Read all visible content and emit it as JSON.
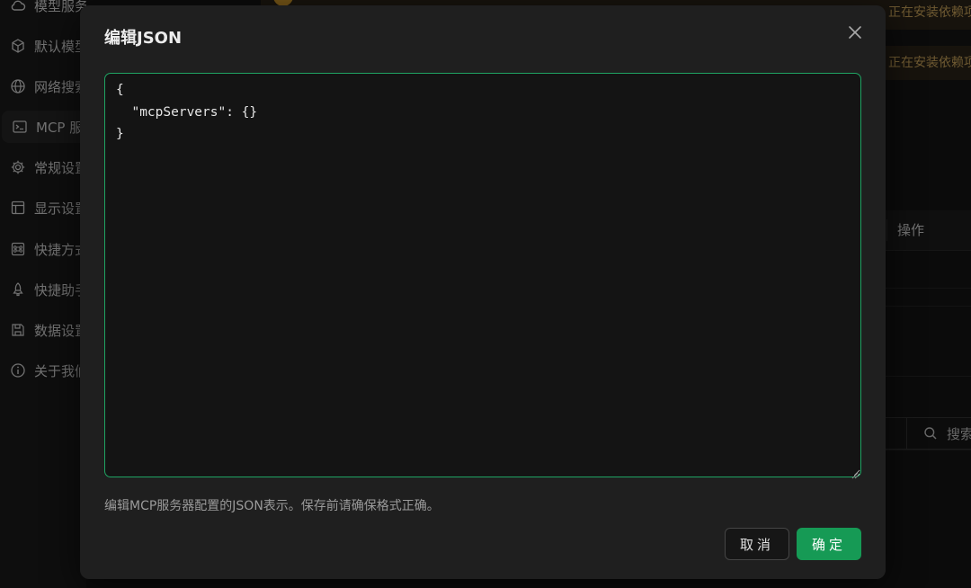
{
  "sidebar": {
    "items": [
      {
        "label": "模型服务",
        "icon": "cloud-icon"
      },
      {
        "label": "默认模型",
        "icon": "cube-icon"
      },
      {
        "label": "网络搜索",
        "icon": "globe-icon"
      },
      {
        "label": "MCP 服务器",
        "icon": "terminal-icon",
        "active": true
      },
      {
        "label": "常规设置",
        "icon": "gear-icon"
      },
      {
        "label": "显示设置",
        "icon": "layout-icon"
      },
      {
        "label": "快捷方式",
        "icon": "command-icon"
      },
      {
        "label": "快捷助手",
        "icon": "rocket-icon"
      },
      {
        "label": "数据设置",
        "icon": "save-icon"
      },
      {
        "label": "关于我们",
        "icon": "info-icon"
      }
    ]
  },
  "background": {
    "notice_1": "正在安装依赖项",
    "notice_2": "正在安装依赖项",
    "table_ops_header": "操作",
    "search_placeholder": "搜索"
  },
  "modal": {
    "title": "编辑JSON",
    "editor_value": "{\n  \"mcpServers\": {}\n}",
    "hint": "编辑MCP服务器配置的JSON表示。保存前请确保格式正确。",
    "cancel_label": "取消",
    "ok_label": "确定"
  },
  "colors": {
    "accent": "#169a55",
    "editor_border": "#1fa463",
    "modal_bg": "#1f1f1f",
    "page_bg": "#141414",
    "notice_text": "#c9a25a"
  }
}
